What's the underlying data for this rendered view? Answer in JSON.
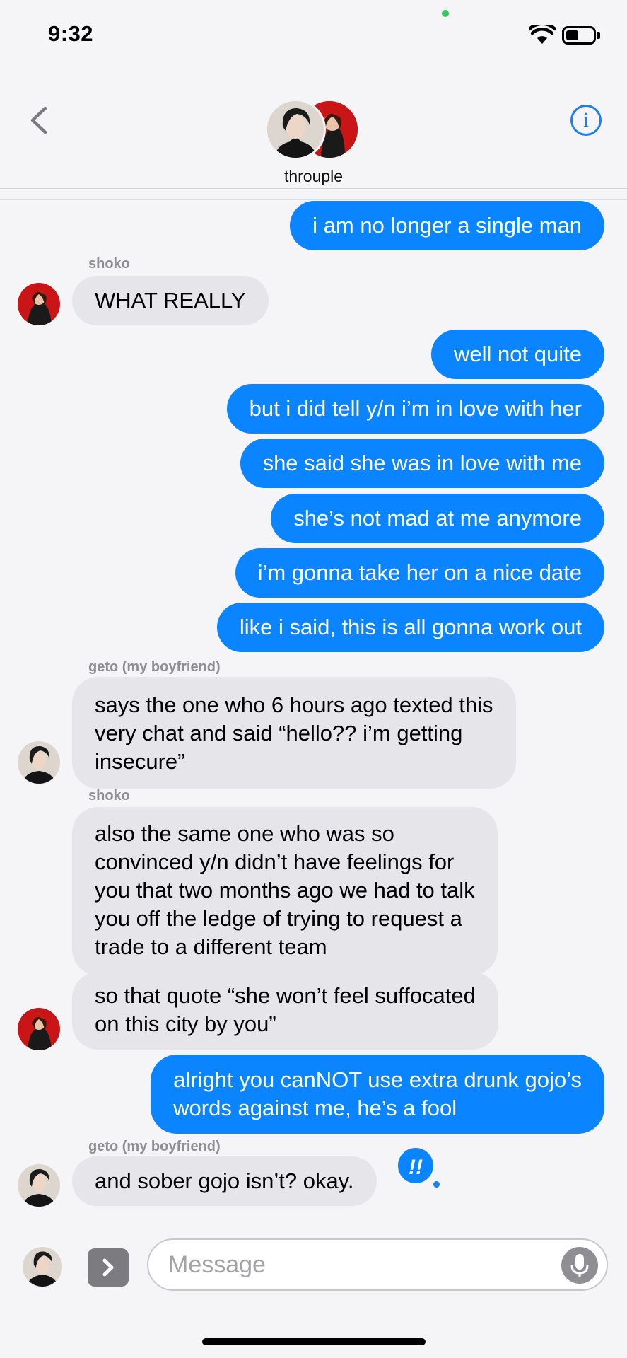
{
  "status_bar": {
    "time": "9:32"
  },
  "header": {
    "group_name": "throuple",
    "info_icon_glyph": "i"
  },
  "messages": [
    {
      "dir": "out",
      "text": "i am no longer a single man"
    },
    {
      "dir": "in",
      "sender": "shoko",
      "text": "WHAT REALLY"
    },
    {
      "dir": "out",
      "text": "well not quite"
    },
    {
      "dir": "out",
      "text": "but i did tell y/n i’m in love with her"
    },
    {
      "dir": "out",
      "text": "she said she was in love with me"
    },
    {
      "dir": "out",
      "text": "she’s not mad at me anymore"
    },
    {
      "dir": "out",
      "text": "i’m gonna take her on a nice date"
    },
    {
      "dir": "out",
      "text": "like i said, this is all gonna work out"
    },
    {
      "dir": "in",
      "sender": "geto (my boyfriend)",
      "text": "says the one who 6 hours ago texted this\nvery chat and said “hello?? i’m getting\ninsecure”"
    },
    {
      "dir": "in",
      "sender": "shoko",
      "text": "also the same one who was so\nconvinced y/n didn’t have feelings for\nyou that two months ago we had to talk\nyou off the ledge of trying to request a\ntrade to a different team"
    },
    {
      "dir": "in",
      "text": "so that quote “she won’t feel suffocated\non this city by you”"
    },
    {
      "dir": "out",
      "text": "alright you canNOT use extra drunk gojo’s\nwords against me, he’s a fool"
    },
    {
      "dir": "in",
      "sender": "geto (my boyfriend)",
      "text": "and sober gojo isn’t? okay.",
      "reaction": "!!"
    }
  ],
  "composer": {
    "placeholder": "Message"
  },
  "colors": {
    "outgoing": "#0a84ff",
    "incoming": "#e5e5ea",
    "accent": "#1a7ff5"
  }
}
